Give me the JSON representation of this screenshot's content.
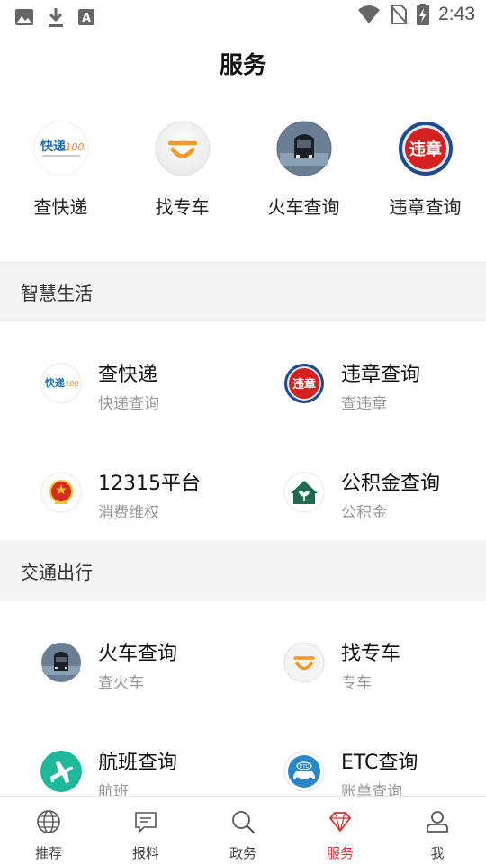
{
  "status_bar": {
    "time": "2:43"
  },
  "page": {
    "title": "服务"
  },
  "quick_links": [
    {
      "label": "查快递",
      "icon": "kuaidi100-logo-icon"
    },
    {
      "label": "找专车",
      "icon": "didi-logo-icon"
    },
    {
      "label": "火车查询",
      "icon": "train-icon"
    },
    {
      "label": "违章查询",
      "icon": "violation-badge-icon"
    }
  ],
  "sections": [
    {
      "title": "智慧生活",
      "items": [
        {
          "title": "查快递",
          "subtitle": "快递查询",
          "icon": "kuaidi100-logo-icon"
        },
        {
          "title": "违章查询",
          "subtitle": "查违章",
          "icon": "violation-badge-icon"
        },
        {
          "title": "12315平台",
          "subtitle": "消费维权",
          "icon": "national-emblem-icon"
        },
        {
          "title": "公积金查询",
          "subtitle": "公积金",
          "icon": "house-icon"
        }
      ]
    },
    {
      "title": "交通出行",
      "items": [
        {
          "title": "火车查询",
          "subtitle": "查火车",
          "icon": "train-icon"
        },
        {
          "title": "找专车",
          "subtitle": "专车",
          "icon": "didi-logo-icon"
        },
        {
          "title": "航班查询",
          "subtitle": "航班",
          "icon": "airplane-icon"
        },
        {
          "title": "ETC查询",
          "subtitle": "账单查询",
          "icon": "etc-car-icon"
        }
      ]
    }
  ],
  "logos": {
    "kuaidi": "快递",
    "kuaidi_num": "100",
    "violation": "违章",
    "etc": "ETC"
  },
  "bottom_nav": [
    {
      "label": "推荐",
      "icon": "globe-icon",
      "active": false
    },
    {
      "label": "报料",
      "icon": "chat-icon",
      "active": false
    },
    {
      "label": "政务",
      "icon": "search-icon",
      "active": false
    },
    {
      "label": "服务",
      "icon": "diamond-icon",
      "active": true
    },
    {
      "label": "我",
      "icon": "user-icon",
      "active": false
    }
  ],
  "colors": {
    "accent": "#d33333",
    "section_bg": "#f4f4f4",
    "subtitle": "#999999"
  }
}
